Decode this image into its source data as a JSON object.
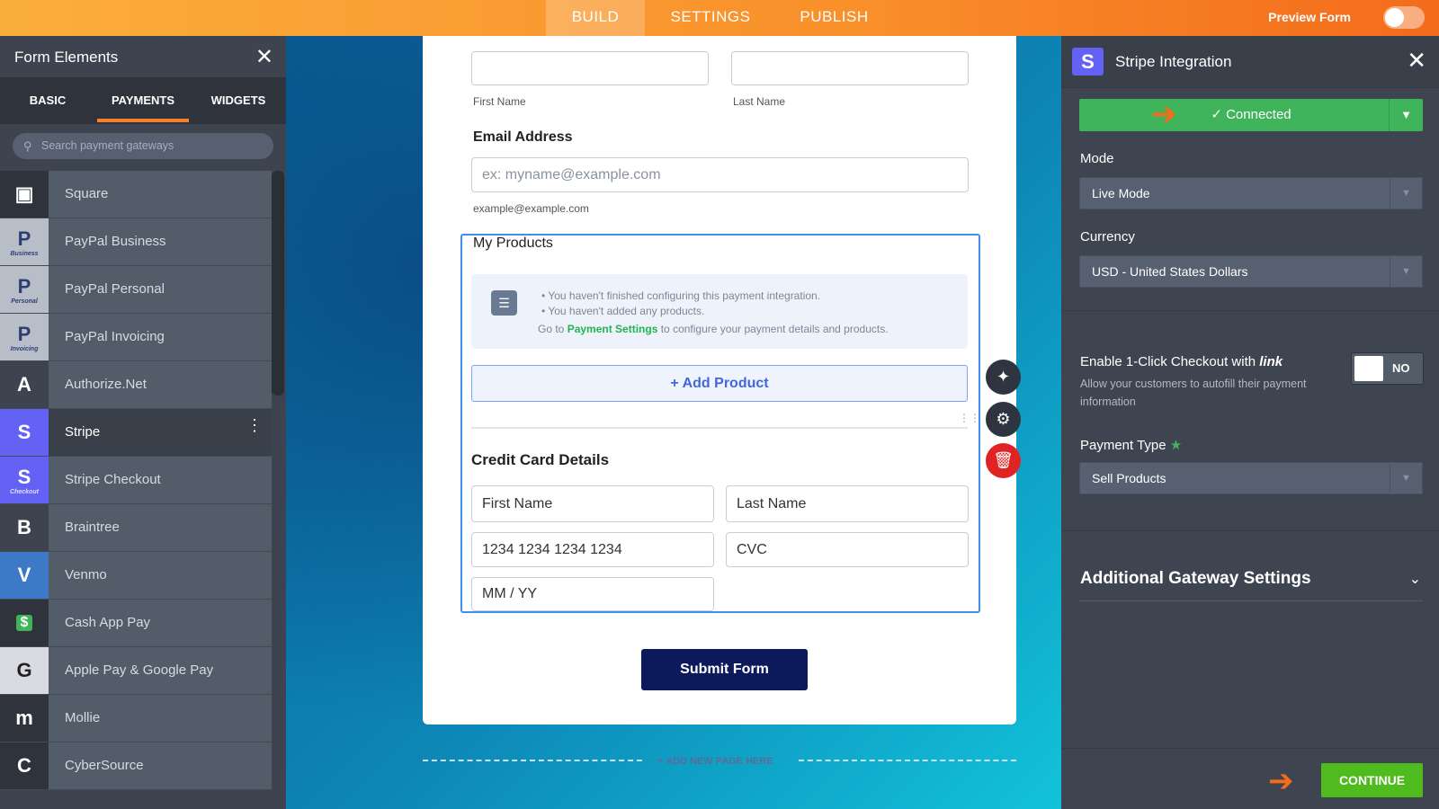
{
  "topbar": {
    "tabs": [
      "BUILD",
      "SETTINGS",
      "PUBLISH"
    ],
    "preview_label": "Preview Form"
  },
  "left": {
    "title": "Form Elements",
    "tabs": [
      "BASIC",
      "PAYMENTS",
      "WIDGETS"
    ],
    "search_placeholder": "Search payment gateways",
    "items": [
      {
        "label": "Square",
        "icon": "▣",
        "sub": ""
      },
      {
        "label": "PayPal Business",
        "icon": "P",
        "sub": "Business"
      },
      {
        "label": "PayPal Personal",
        "icon": "P",
        "sub": "Personal"
      },
      {
        "label": "PayPal Invoicing",
        "icon": "P",
        "sub": "Invoicing"
      },
      {
        "label": "Authorize.Net",
        "icon": "A",
        "sub": ""
      },
      {
        "label": "Stripe",
        "icon": "S",
        "sub": ""
      },
      {
        "label": "Stripe Checkout",
        "icon": "S",
        "sub": "Checkout"
      },
      {
        "label": "Braintree",
        "icon": "B",
        "sub": ""
      },
      {
        "label": "Venmo",
        "icon": "V",
        "sub": ""
      },
      {
        "label": "Cash App Pay",
        "icon": "$",
        "sub": ""
      },
      {
        "label": "Apple Pay & Google Pay",
        "icon": "G",
        "sub": ""
      },
      {
        "label": "Mollie",
        "icon": "m",
        "sub": ""
      },
      {
        "label": "CyberSource",
        "icon": "C",
        "sub": ""
      }
    ]
  },
  "form": {
    "first_name": "First Name",
    "last_name": "Last Name",
    "email_label": "Email Address",
    "email_placeholder": "ex: myname@example.com",
    "email_hint": "example@example.com",
    "products_title": "My Products",
    "notice": [
      "You haven't finished configuring this payment integration.",
      "You haven't added any products."
    ],
    "notice_pre": "Go to ",
    "notice_link": "Payment Settings",
    "notice_post": " to configure your payment details and products.",
    "add_product": "+ Add Product",
    "cc_title": "Credit Card Details",
    "cc_first": "First Name",
    "cc_last": "Last Name",
    "cc_number": "1234 1234 1234 1234",
    "cc_cvc": "CVC",
    "cc_exp": "MM / YY",
    "submit": "Submit Form",
    "add_page": "+ ADD NEW PAGE HERE"
  },
  "right": {
    "title": "Stripe Integration",
    "connected": "✓ Connected",
    "mode_label": "Mode",
    "mode_value": "Live Mode",
    "currency_label": "Currency",
    "currency_value": "USD - United States Dollars",
    "link_label": "Enable 1-Click Checkout with",
    "link_brand": "link",
    "link_desc": "Allow your customers to autofill their payment information",
    "toggle": "NO",
    "payment_type_label": "Payment Type",
    "payment_type_value": "Sell Products",
    "additional": "Additional Gateway Settings",
    "continue": "CONTINUE"
  },
  "colors": {
    "accent": "#f46b1c",
    "connected": "#3fb45a",
    "continue": "#4fbb1e",
    "stripe": "#6461f5"
  }
}
